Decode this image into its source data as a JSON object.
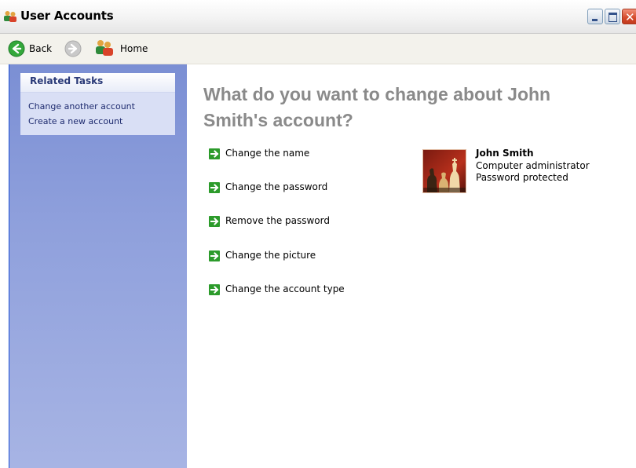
{
  "window": {
    "title": "User Accounts",
    "icon": "users-icon"
  },
  "toolbar": {
    "back_label": "Back",
    "home_label": "Home"
  },
  "sidebar": {
    "panel_title": "Related Tasks",
    "tasks": [
      "Change another account",
      "Create a new account"
    ]
  },
  "main": {
    "heading": "What do you want to change about John Smith's account?",
    "options": [
      "Change the name",
      "Change the password",
      "Remove the password",
      "Change the picture",
      "Change the account type"
    ]
  },
  "user": {
    "name": "John Smith",
    "type": "Computer administrator",
    "status": "Password protected",
    "picture": "chess-pieces-picture"
  },
  "colors": {
    "sidebar_gradient_top": "#7b8fd4",
    "sidebar_gradient_bottom": "#a7b4e4",
    "link_color": "#1e2b6f",
    "arrow_green": "#2c9b2b",
    "heading_gray": "#8a8a8a"
  }
}
